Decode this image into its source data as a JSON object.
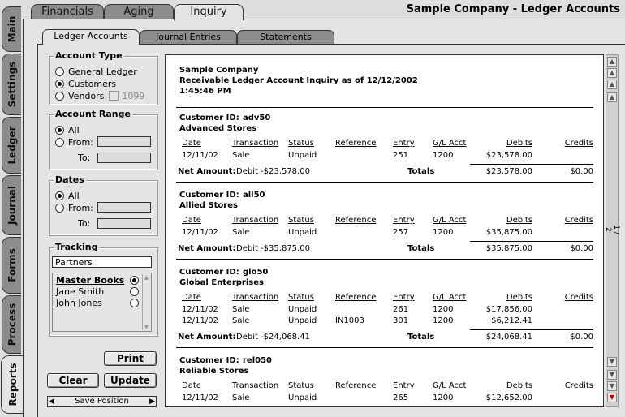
{
  "company_title": "Sample Company - Ledger Accounts",
  "top_tabs": [
    "Financials",
    "Aging",
    "Inquiry"
  ],
  "side_tabs": [
    "Main",
    "Settings",
    "Ledger",
    "Journal",
    "Forms",
    "Process",
    "Reports"
  ],
  "sub_tabs": [
    "Ledger Accounts",
    "Journal Entries",
    "Statements"
  ],
  "account_type": {
    "title": "Account Type",
    "options": [
      "General Ledger",
      "Customers",
      "Vendors"
    ],
    "selected": "Customers",
    "check_1099": "1099"
  },
  "account_range": {
    "title": "Account Range",
    "all": "All",
    "from": "From:",
    "to": "To:"
  },
  "dates": {
    "title": "Dates",
    "all": "All",
    "from": "From:",
    "to": "To:"
  },
  "tracking": {
    "title": "Tracking",
    "value": "Partners",
    "list_header": "Master Books",
    "items": [
      "Jane Smith",
      "John Jones"
    ]
  },
  "buttons": {
    "print": "Print",
    "clear": "Clear",
    "update": "Update",
    "save_position": "Save Position"
  },
  "report": {
    "company": "Sample Company",
    "title": "Receivable Ledger Account Inquiry as of 12/12/2002",
    "time": "1:45:46 PM",
    "headers": {
      "date": "Date",
      "transaction": "Transaction",
      "status": "Status",
      "reference": "Reference",
      "entry": "Entry",
      "gl": "G/L Acct",
      "debits": "Debits",
      "credits": "Credits"
    },
    "customer_label": "Customer ID:",
    "net_label": "Net Amount:",
    "totals_label": "Totals",
    "customers": [
      {
        "id": "adv50",
        "name": "Advanced Stores",
        "rows": [
          {
            "date": "12/11/02",
            "transaction": "Sale",
            "status": "Unpaid",
            "reference": "",
            "entry": "251",
            "gl": "1200",
            "debits": "$23,578.00",
            "credits": ""
          }
        ],
        "net": "Debit -$23,578.00",
        "total_debits": "$23,578.00",
        "total_credits": "$0.00"
      },
      {
        "id": "all50",
        "name": "Allied Stores",
        "rows": [
          {
            "date": "12/11/02",
            "transaction": "Sale",
            "status": "Unpaid",
            "reference": "",
            "entry": "257",
            "gl": "1200",
            "debits": "$35,875.00",
            "credits": ""
          }
        ],
        "net": "Debit -$35,875.00",
        "total_debits": "$35,875.00",
        "total_credits": "$0.00"
      },
      {
        "id": "glo50",
        "name": "Global Enterprises",
        "rows": [
          {
            "date": "12/11/02",
            "transaction": "Sale",
            "status": "Unpaid",
            "reference": "",
            "entry": "261",
            "gl": "1200",
            "debits": "$17,856.00",
            "credits": ""
          },
          {
            "date": "12/11/02",
            "transaction": "Sale",
            "status": "Unpaid",
            "reference": "IN1003",
            "entry": "301",
            "gl": "1200",
            "debits": "$6,212.41",
            "credits": ""
          }
        ],
        "net": "Debit -$24,068.41",
        "total_debits": "$24,068.41",
        "total_credits": "$0.00"
      },
      {
        "id": "rel050",
        "name": "Reliable Stores",
        "rows": [
          {
            "date": "12/11/02",
            "transaction": "Sale",
            "status": "Unpaid",
            "reference": "",
            "entry": "265",
            "gl": "1200",
            "debits": "$12,652.00",
            "credits": ""
          }
        ],
        "net": "",
        "total_debits": "",
        "total_credits": ""
      }
    ]
  },
  "page_indicator": "1 / 2"
}
